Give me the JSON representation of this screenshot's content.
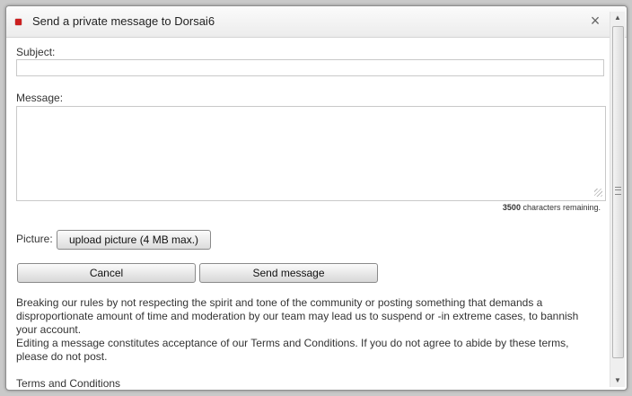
{
  "dialog": {
    "title": "Send a private message to Dorsai6",
    "close_glyph": "×",
    "icon": "red-square-icon",
    "icon_color": "#cc1f1f"
  },
  "form": {
    "subject_label": "Subject:",
    "subject_value": "",
    "message_label": "Message:",
    "message_value": "",
    "chars_count": "3500",
    "chars_suffix": " characters remaining.",
    "picture_label": "Picture:",
    "upload_label": "upload picture (4 MB max.)"
  },
  "actions": {
    "cancel_label": "Cancel",
    "send_label": "Send message"
  },
  "info": {
    "rules_text": "Breaking our rules by not respecting the spirit and tone of the community or posting something that demands a disproportionate amount of time and moderation by our team may lead us to suspend or -in extreme cases, to bannish your account.",
    "terms_text": "Editing a message constitutes acceptance of our Terms and Conditions. If you do not agree to abide by these terms, please do not post.",
    "terms_link": "Terms and Conditions"
  },
  "scrollbar": {
    "up_glyph": "▲",
    "down_glyph": "▼"
  }
}
